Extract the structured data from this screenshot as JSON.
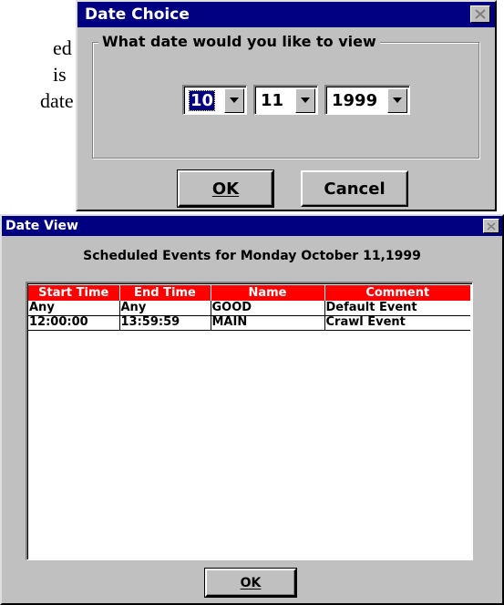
{
  "background_text": [
    "ed",
    "is",
    "date"
  ],
  "date_choice": {
    "title": "Date Choice",
    "group_label": "What date would you like to view",
    "month": "10",
    "day": "11",
    "year": "1999",
    "ok_label": "OK",
    "cancel_label": "Cancel"
  },
  "date_view": {
    "title": "Date View",
    "heading": "Scheduled Events for Monday October 11,1999",
    "columns": [
      "Start Time",
      "End Time",
      "Name",
      "Comment"
    ],
    "rows": [
      [
        "Any",
        "Any",
        "GOOD",
        "Default Event"
      ],
      [
        "12:00:00",
        "13:59:59",
        "MAIN",
        "Crawl Event"
      ]
    ],
    "ok_label": "OK"
  },
  "colors": {
    "titlebar": "#000080",
    "face": "#c0c0c0",
    "header_red": "#ff0000"
  },
  "icons": [
    "close-icon",
    "dropdown-arrow-icon"
  ]
}
